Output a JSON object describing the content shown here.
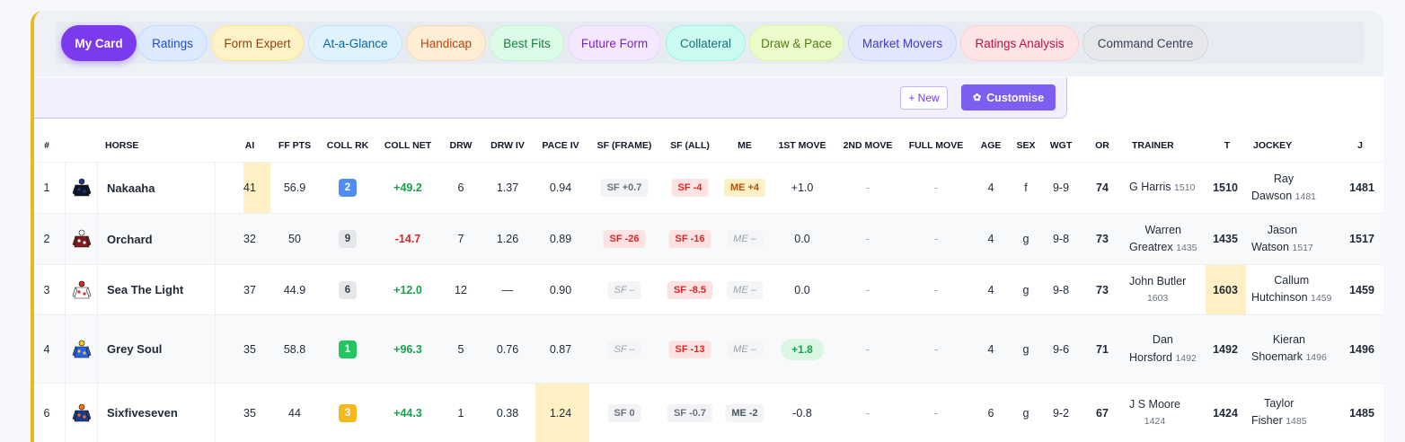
{
  "tabs": [
    {
      "label": "My Card",
      "active": true,
      "bg": "#7c3aed",
      "fg": "#ffffff",
      "border": "#7c3aed"
    },
    {
      "label": "Ratings",
      "bg": "#dbeafe",
      "fg": "#1d4ed8",
      "border": "#bfdbfe"
    },
    {
      "label": "Form Expert",
      "bg": "#fef3c7",
      "fg": "#92400e",
      "border": "#fde68a"
    },
    {
      "label": "At-a-Glance",
      "bg": "#e0f2fe",
      "fg": "#0369a1",
      "border": "#bae6fd"
    },
    {
      "label": "Handicap",
      "bg": "#ffedd5",
      "fg": "#c2410c",
      "border": "#fed7aa"
    },
    {
      "label": "Best Fits",
      "bg": "#dcfce7",
      "fg": "#15803d",
      "border": "#bbf7d0"
    },
    {
      "label": "Future Form",
      "bg": "#f3e8ff",
      "fg": "#7e22ce",
      "border": "#e9d5ff"
    },
    {
      "label": "Collateral",
      "bg": "#ccfbf1",
      "fg": "#0f766e",
      "border": "#99f6e4"
    },
    {
      "label": "Draw & Pace",
      "bg": "#ecfccb",
      "fg": "#4d7c0f",
      "border": "#d9f99d"
    },
    {
      "label": "Market Movers",
      "bg": "#e0e7ff",
      "fg": "#4338ca",
      "border": "#c7d2fe"
    },
    {
      "label": "Ratings Analysis",
      "bg": "#ffe4e6",
      "fg": "#be123c",
      "border": "#fecdd3"
    },
    {
      "label": "Command Centre",
      "bg": "#e5e7eb",
      "fg": "#374151",
      "border": "#d1d5db"
    }
  ],
  "toolbar": {
    "new_label": "+ New",
    "customise_label": "Customise",
    "gear_icon": "gear-icon"
  },
  "headers": {
    "num": "#",
    "horse": "HORSE",
    "ai": "AI",
    "ff_pts": "FF PTS",
    "coll_rk": "COLL RK",
    "coll_net": "COLL NET",
    "drw": "DRW",
    "drw_iv": "DRW IV",
    "pace_iv": "PACE IV",
    "sf_frame": "SF (FRAME)",
    "sf_all": "SF (ALL)",
    "me": "ME",
    "move1": "1ST MOVE",
    "move2": "2ND MOVE",
    "full_move": "FULL MOVE",
    "age": "AGE",
    "sex": "SEX",
    "wgt": "WGT",
    "or": "OR",
    "trainer": "TRAINER",
    "t": "T",
    "jockey": "JOCKEY",
    "j": "J"
  },
  "rows": [
    {
      "num": "1",
      "horse": "Nakaaha",
      "silk_colors": [
        "#0f172a",
        "#1e3a8a"
      ],
      "ai": "41",
      "ff_pts": "56.9",
      "coll_rk": "2",
      "coll_rk_style": "blue",
      "coll_net": "+49.2",
      "coll_net_dir": "up",
      "drw": "6",
      "drw_iv": "1.37",
      "pace_iv": "0.94",
      "sf_frame": "SF +0.7",
      "sf_frame_style": "gray",
      "sf_all": "SF -4",
      "sf_all_style": "red",
      "me": "ME +4",
      "me_style": "yellow",
      "move1": "+1.0",
      "move2": "-",
      "full_move": "-",
      "age": "4",
      "sex": "f",
      "wgt": "9-9",
      "or": "74",
      "trainer": "G Harris",
      "trainer_rating": "1510",
      "t": "1510",
      "jockey": "Ray",
      "jockey_line2": "Dawson",
      "jockey_rating": "1481",
      "j": "1481"
    },
    {
      "num": "2",
      "horse": "Orchard",
      "silk_colors": [
        "#7f1d1d",
        "#ffffff"
      ],
      "ai": "32",
      "ff_pts": "50",
      "coll_rk": "9",
      "coll_rk_style": "gray",
      "coll_net": "-14.7",
      "coll_net_dir": "down",
      "drw": "7",
      "drw_iv": "1.26",
      "pace_iv": "0.89",
      "sf_frame": "SF -26",
      "sf_frame_style": "red",
      "sf_all": "SF -16",
      "sf_all_style": "red",
      "me": "ME –",
      "me_style": "dim",
      "move1": "0.0",
      "move2": "-",
      "full_move": "-",
      "age": "4",
      "sex": "g",
      "wgt": "9-8",
      "or": "73",
      "trainer": "Warren",
      "trainer_line2": "Greatrex",
      "trainer_rating": "1435",
      "t": "1435",
      "jockey": "Jason",
      "jockey_line2": "Watson",
      "jockey_rating": "1517",
      "j": "1517"
    },
    {
      "num": "3",
      "horse": "Sea The Light",
      "silk_colors": [
        "#ffffff",
        "#dc2626"
      ],
      "ai": "37",
      "ff_pts": "44.9",
      "coll_rk": "6",
      "coll_rk_style": "gray",
      "coll_net": "+12.0",
      "coll_net_dir": "up",
      "drw": "12",
      "drw_iv": "—",
      "pace_iv": "0.90",
      "sf_frame": "SF –",
      "sf_frame_style": "dim",
      "sf_all": "SF -8.5",
      "sf_all_style": "red",
      "me": "ME –",
      "me_style": "dim",
      "move1": "0.0",
      "move2": "-",
      "full_move": "-",
      "age": "4",
      "sex": "g",
      "wgt": "9-8",
      "or": "73",
      "trainer": "John Butler",
      "trainer_rating": "1603",
      "t": "1603",
      "jockey": "Callum",
      "jockey_line2": "Hutchinson",
      "jockey_rating": "1459",
      "j": "1459"
    },
    {
      "num": "4",
      "horse": "Grey Soul",
      "silk_colors": [
        "#2563eb",
        "#facc15"
      ],
      "ai": "35",
      "ff_pts": "58.8",
      "coll_rk": "1",
      "coll_rk_style": "green",
      "coll_net": "+96.3",
      "coll_net_dir": "up",
      "drw": "5",
      "drw_iv": "0.76",
      "pace_iv": "0.87",
      "sf_frame": "SF –",
      "sf_frame_style": "dim",
      "sf_all": "SF -13",
      "sf_all_style": "red",
      "me": "ME –",
      "me_style": "dim",
      "move1": "+1.8",
      "move1_pill": true,
      "move2": "-",
      "full_move": "-",
      "age": "4",
      "sex": "g",
      "wgt": "9-6",
      "or": "71",
      "trainer": "Dan",
      "trainer_line2": "Horsford",
      "trainer_rating": "1492",
      "t": "1492",
      "jockey": "Kieran",
      "jockey_line2": "Shoemark",
      "jockey_rating": "1496",
      "j": "1496"
    },
    {
      "num": "6",
      "horse": "Sixfiveseven",
      "silk_colors": [
        "#1e3a8a",
        "#f97316"
      ],
      "ai": "35",
      "ff_pts": "44",
      "coll_rk": "3",
      "coll_rk_style": "yellow",
      "coll_net": "+44.3",
      "coll_net_dir": "up",
      "drw": "1",
      "drw_iv": "0.38",
      "pace_iv": "1.24",
      "sf_frame": "SF 0",
      "sf_frame_style": "gray",
      "sf_all": "SF -0.7",
      "sf_all_style": "gray",
      "me": "ME -2",
      "me_style": "mute",
      "move1": "-0.8",
      "move2": "-",
      "full_move": "-",
      "age": "6",
      "sex": "g",
      "wgt": "9-2",
      "or": "67",
      "trainer": "J S Moore",
      "trainer_rating": "1424",
      "t": "1424",
      "jockey": "Taylor",
      "jockey_line2": "Fisher",
      "jockey_rating": "1485",
      "j": "1485"
    }
  ]
}
